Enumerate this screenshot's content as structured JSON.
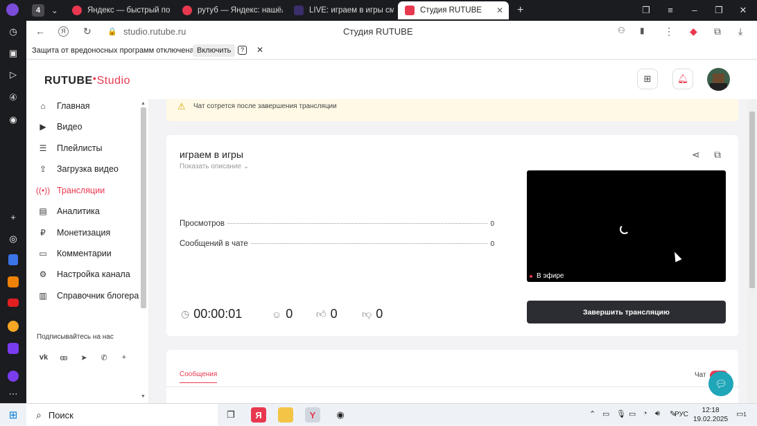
{
  "browser": {
    "tabs": [
      {
        "label": "Яндекс — быстрый поиск",
        "favicon_color": "#e8384f"
      },
      {
        "label": "рутуб — Яндекс: нашёлся",
        "favicon_color": "#e8384f"
      },
      {
        "label": "LIVE: играем в игры смот",
        "favicon_color": "#3a2f6b"
      },
      {
        "label": "Студия RUTUBE",
        "favicon_color": "#e8384f"
      }
    ],
    "tab_counter": "4",
    "new_tab": "+",
    "url": "studio.rutube.ru",
    "page_title": "Студия RUTUBE"
  },
  "security_bar": {
    "message": "Защита от вредоносных программ отключена",
    "enable_label": "Включить",
    "help": "?",
    "close": "✕"
  },
  "header": {
    "logo_main": "RUTUBE",
    "logo_sub": "Studio"
  },
  "sidebar": {
    "items": [
      {
        "label": "Главная",
        "icon": "home-icon"
      },
      {
        "label": "Видео",
        "icon": "video-icon"
      },
      {
        "label": "Плейлисты",
        "icon": "playlist-icon"
      },
      {
        "label": "Загрузка видео",
        "icon": "upload-icon"
      },
      {
        "label": "Трансляции",
        "icon": "broadcast-icon",
        "active": true
      },
      {
        "label": "Аналитика",
        "icon": "analytics-icon"
      },
      {
        "label": "Монетизация",
        "icon": "money-icon"
      },
      {
        "label": "Комментарии",
        "icon": "comments-icon"
      },
      {
        "label": "Настройка канала",
        "icon": "gear-icon"
      },
      {
        "label": "Справочник блогера",
        "icon": "book-icon"
      }
    ],
    "follow_label": "Подписывайтесь на нас",
    "socials": [
      "vk",
      "ok",
      "telegram",
      "viber",
      "+"
    ]
  },
  "warning": {
    "text": "Чат сотрется после завершения трансляции"
  },
  "stream": {
    "title": "играем в игры",
    "show_description": "Показать описание",
    "stats": [
      {
        "label": "Просмотров",
        "value": "0"
      },
      {
        "label": "Сообщений в чате",
        "value": "0"
      }
    ],
    "live_badge": "В эфире",
    "end_button": "Завершить трансляцию",
    "timer": "00:00:01",
    "viewers": "0",
    "likes": "0",
    "dislikes": "0"
  },
  "tabs": {
    "messages": "Сообщения",
    "chat": "Чат"
  },
  "taskbar": {
    "search_label": "Поиск",
    "language": "РУС",
    "time": "12:18",
    "date": "19.02.2025",
    "notifications": "1"
  },
  "colors": {
    "accent": "#e8384f",
    "dark_button": "#2c2d33",
    "support": "#1fa6b8"
  }
}
